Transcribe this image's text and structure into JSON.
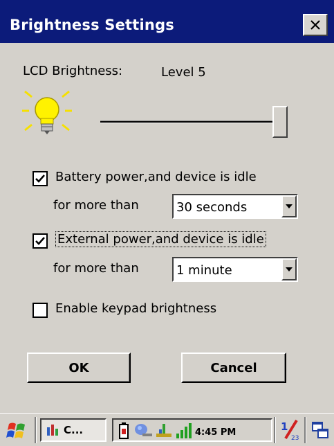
{
  "window": {
    "title": "Brightness Settings"
  },
  "lcd": {
    "label": "LCD Brightness:",
    "level_text": "Level 5",
    "level_fraction": 1.0
  },
  "battery": {
    "checked": true,
    "label": "Battery power,and device is idle",
    "for_label": "for more than",
    "timeout": "30 seconds"
  },
  "external": {
    "checked": true,
    "label": "External power,and device is idle",
    "for_label": "for more than",
    "timeout": "1 minute"
  },
  "keypad": {
    "checked": false,
    "label": "Enable keypad brightness"
  },
  "buttons": {
    "ok": "OK",
    "cancel": "Cancel"
  },
  "taskbar": {
    "task_label": "C...",
    "clock": "4:45 PM",
    "icons": [
      "start-flag-icon",
      "app-icon",
      "battery-icon",
      "network-icon",
      "usb-icon",
      "signal-icon",
      "input-panel-icon",
      "windows-icon"
    ]
  },
  "colors": {
    "titlebar": "#0c1b7a",
    "panel": "#d4d1cb",
    "bulb": "#fff200"
  }
}
